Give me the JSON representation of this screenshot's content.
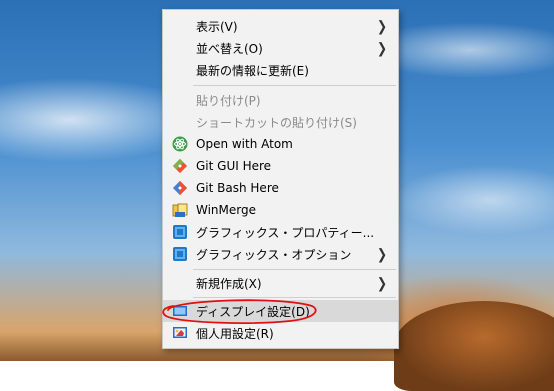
{
  "menu": {
    "view": "表示(V)",
    "sort": "並べ替え(O)",
    "refresh": "最新の情報に更新(E)",
    "paste": "貼り付け(P)",
    "paste_shortcut": "ショートカットの貼り付け(S)",
    "open_atom": "Open with Atom",
    "git_gui": "Git GUI Here",
    "git_bash": "Git Bash Here",
    "winmerge": "WinMerge",
    "graphics_props": "グラフィックス・プロパティー...",
    "graphics_options": "グラフィックス・オプション",
    "new": "新規作成(X)",
    "display_settings": "ディスプレイ設定(D)",
    "personalize": "個人用設定(R)"
  },
  "annotation_color": "#e01010"
}
